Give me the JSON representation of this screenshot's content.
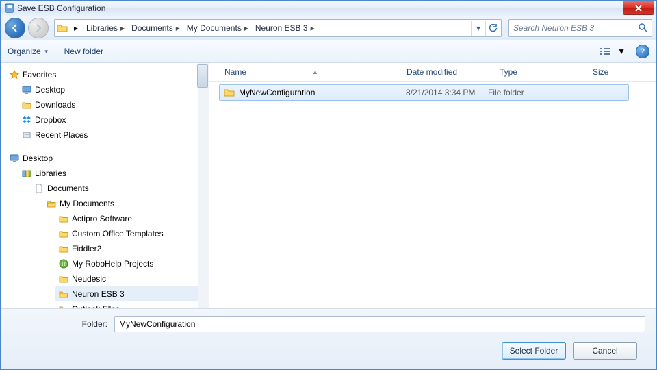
{
  "window": {
    "title": "Save ESB Configuration"
  },
  "nav": {
    "crumbs": [
      "Libraries",
      "Documents",
      "My Documents",
      "Neuron ESB 3"
    ],
    "search_placeholder": "Search Neuron ESB 3"
  },
  "toolbar": {
    "organize": "Organize",
    "newfolder": "New folder"
  },
  "favorites": {
    "header": "Favorites",
    "items": [
      "Desktop",
      "Downloads",
      "Dropbox",
      "Recent Places"
    ]
  },
  "tree": {
    "desktop": "Desktop",
    "libraries": "Libraries",
    "documents": "Documents",
    "mydocs": "My Documents",
    "children": [
      "Actipro Software",
      "Custom Office Templates",
      "Fiddler2",
      "My RoboHelp Projects",
      "Neudesic",
      "Neuron ESB 3",
      "Outlook Files"
    ]
  },
  "columns": {
    "name": "Name",
    "date": "Date modified",
    "type": "Type",
    "size": "Size"
  },
  "files": [
    {
      "name": "MyNewConfiguration",
      "date": "8/21/2014 3:34 PM",
      "type": "File folder"
    }
  ],
  "footer": {
    "folder_label": "Folder:",
    "folder_value": "MyNewConfiguration",
    "select": "Select Folder",
    "cancel": "Cancel"
  }
}
